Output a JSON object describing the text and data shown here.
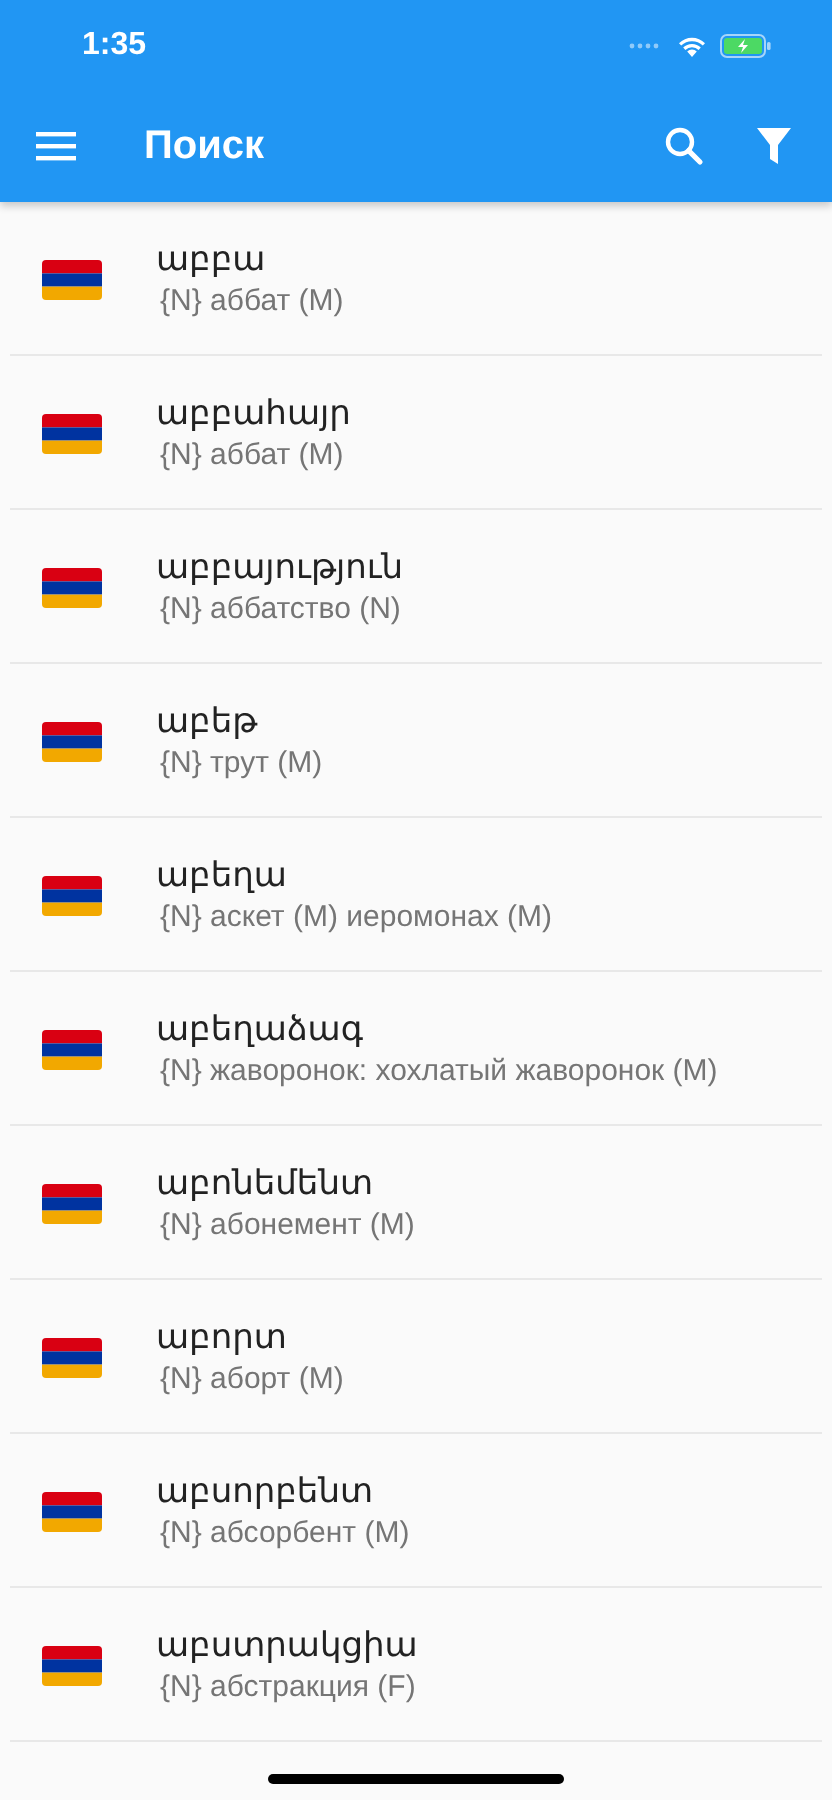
{
  "status_bar": {
    "time": "1:35"
  },
  "app_bar": {
    "title": "Поиск"
  },
  "results": [
    {
      "word": "աբբա",
      "translation": "{N} аббат (M)"
    },
    {
      "word": "աբբահայր",
      "translation": "{N} аббат (M)"
    },
    {
      "word": "աբբայություն",
      "translation": "{N} аббатство (N)"
    },
    {
      "word": "աբեթ",
      "translation": "{N} трут (M)"
    },
    {
      "word": "աբեղա",
      "translation": "{N} аскет (M) иеромонах (M)"
    },
    {
      "word": "աբեղաձագ",
      "translation": "{N} жаворонок: хохлатый жаворонок (M)"
    },
    {
      "word": "աբոնեմենտ",
      "translation": "{N} абонемент (M)"
    },
    {
      "word": "աբորտ",
      "translation": "{N} аборт (M)"
    },
    {
      "word": "աբսորբենտ",
      "translation": "{N} абсорбент (M)"
    },
    {
      "word": "աբստրակցիա",
      "translation": "{N} абстракция (F)"
    }
  ]
}
